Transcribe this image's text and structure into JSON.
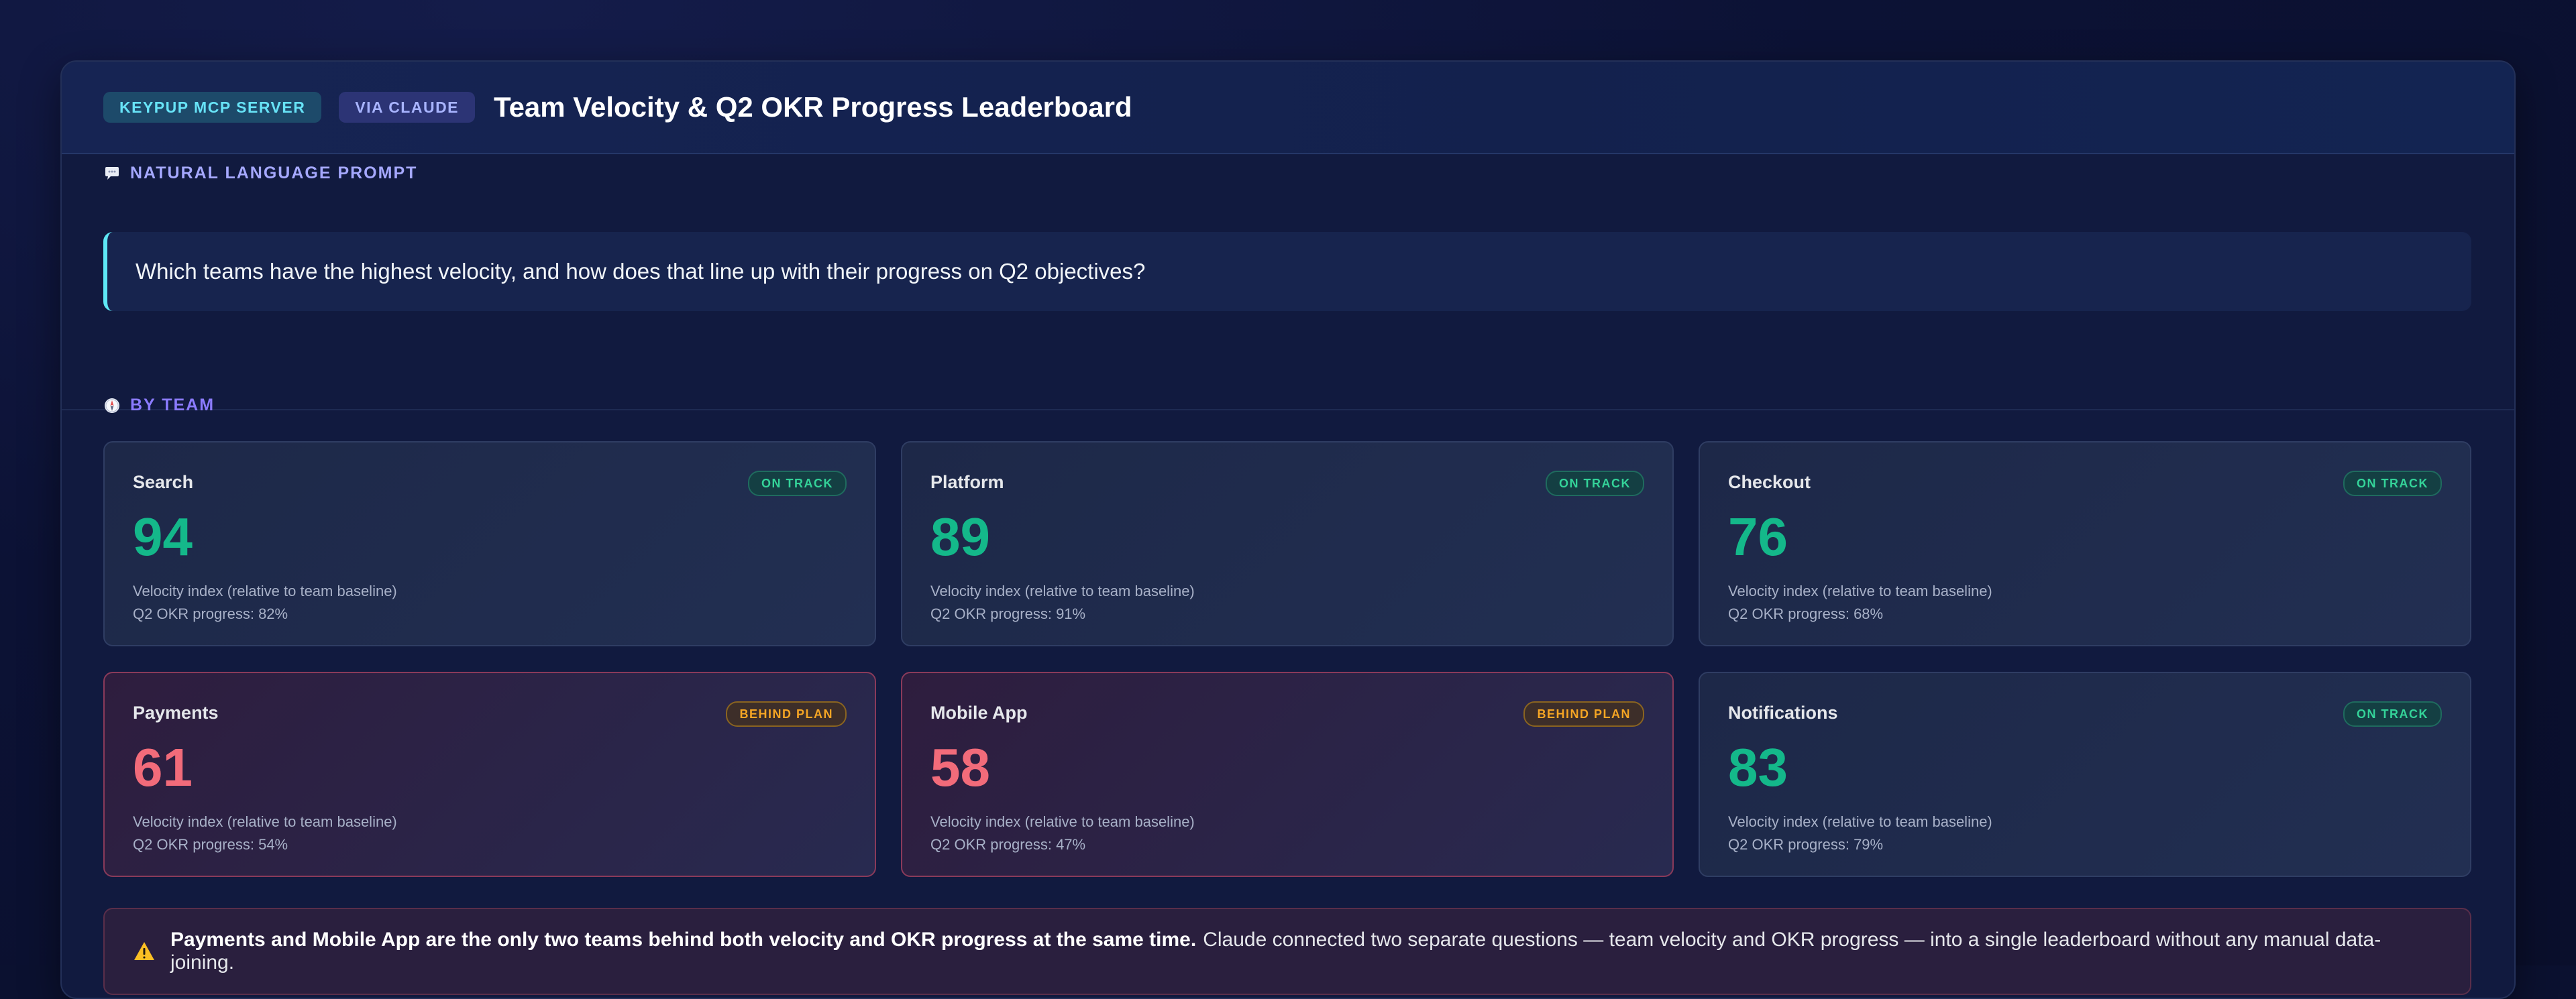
{
  "header": {
    "pill_server": "KEYPUP MCP SERVER",
    "pill_claude": "VIA CLAUDE",
    "title": "Team Velocity & Q2 OKR Progress Leaderboard"
  },
  "prompt": {
    "label": "NATURAL LANGUAGE PROMPT",
    "icon": "speech-bubble-icon",
    "text": "Which teams have the highest velocity, and how does that line up with their progress on Q2 objectives?"
  },
  "by_team": {
    "label": "BY TEAM",
    "icon": "compass-icon",
    "cards": [
      {
        "name": "Search",
        "status": "ON TRACK",
        "value": "94",
        "sub1": "Velocity index (relative to team baseline)",
        "sub2": "Q2 OKR progress: 82%"
      },
      {
        "name": "Platform",
        "status": "ON TRACK",
        "value": "89",
        "sub1": "Velocity index (relative to team baseline)",
        "sub2": "Q2 OKR progress: 91%"
      },
      {
        "name": "Checkout",
        "status": "ON TRACK",
        "value": "76",
        "sub1": "Velocity index (relative to team baseline)",
        "sub2": "Q2 OKR progress: 68%"
      },
      {
        "name": "Payments",
        "status": "BEHIND PLAN",
        "value": "61",
        "sub1": "Velocity index (relative to team baseline)",
        "sub2": "Q2 OKR progress: 54%"
      },
      {
        "name": "Mobile App",
        "status": "BEHIND PLAN",
        "value": "58",
        "sub1": "Velocity index (relative to team baseline)",
        "sub2": "Q2 OKR progress: 47%"
      },
      {
        "name": "Notifications",
        "status": "ON TRACK",
        "value": "83",
        "sub1": "Velocity index (relative to team baseline)",
        "sub2": "Q2 OKR progress: 79%"
      }
    ]
  },
  "alert": {
    "icon": "warning-icon",
    "bold": "Payments and Mobile App are the only two teams behind both velocity and OKR progress at the same time.",
    "text": "Claude connected two separate questions — team velocity and OKR progress — into a single leaderboard without any manual data-joining."
  },
  "colors": {
    "on_track": "#14b88a",
    "behind_plan": "#f26b7a",
    "badge_behind": "#f5a524",
    "accent_cyan": "#5ee7f5"
  }
}
